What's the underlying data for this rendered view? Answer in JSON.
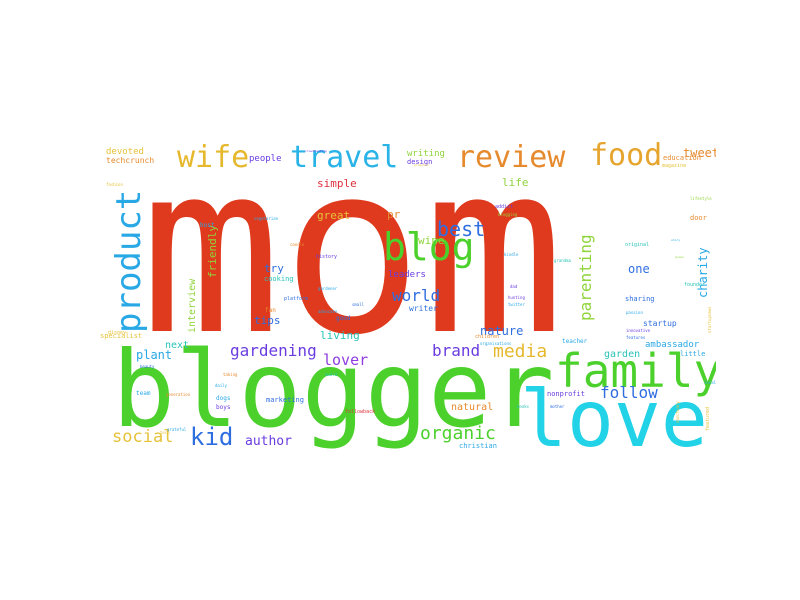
{
  "colors": {
    "red": "#e03a1e",
    "green": "#4cd12c",
    "cyan": "#22d2e6",
    "orange": "#e68a2e",
    "blue": "#2f6ee0",
    "purple": "#6a3ce0",
    "yellow": "#e6c23a",
    "lime": "#8fd43a",
    "teal": "#29c3b8"
  },
  "words": [
    {
      "text": "mom",
      "color": "#e03a1e"
    },
    {
      "text": "blogger",
      "color": "#4cd12c"
    },
    {
      "text": "love",
      "color": "#22d2e6"
    },
    {
      "text": "family",
      "color": "#4cd12c"
    },
    {
      "text": "review",
      "color": "#e68a2e"
    },
    {
      "text": "food",
      "color": "#e6a52e"
    },
    {
      "text": "travel",
      "color": "#29b3e6"
    },
    {
      "text": "wife",
      "color": "#e6b82e"
    },
    {
      "text": "product",
      "color": "#29a8e6"
    },
    {
      "text": "blog",
      "color": "#4cd12c"
    },
    {
      "text": "best",
      "color": "#2f6ee0"
    },
    {
      "text": "world",
      "color": "#2f6ee0"
    },
    {
      "text": "parenting",
      "color": "#8fd43a"
    },
    {
      "text": "kid",
      "color": "#2f6ee0"
    },
    {
      "text": "gardening",
      "color": "#6a3ce0"
    },
    {
      "text": "brand",
      "color": "#6a3ce0"
    },
    {
      "text": "media",
      "color": "#e6b82e"
    },
    {
      "text": "organic",
      "color": "#4cd12c"
    },
    {
      "text": "social",
      "color": "#e6c23a"
    },
    {
      "text": "follow",
      "color": "#2f6ee0"
    },
    {
      "text": "lover",
      "color": "#8f3ce0"
    },
    {
      "text": "author",
      "color": "#6a3ce0"
    },
    {
      "text": "living",
      "color": "#29c3b8"
    },
    {
      "text": "nature",
      "color": "#2f6ee0"
    },
    {
      "text": "plant",
      "color": "#29a8e6"
    },
    {
      "text": "one",
      "color": "#2f6ee0"
    },
    {
      "text": "charity",
      "color": "#29a8e6"
    },
    {
      "text": "tweet",
      "color": "#e68a2e"
    },
    {
      "text": "life",
      "color": "#8fd43a"
    },
    {
      "text": "simple",
      "color": "#e0303e"
    },
    {
      "text": "wine",
      "color": "#8fd43a"
    },
    {
      "text": "pr",
      "color": "#e68a2e"
    },
    {
      "text": "great",
      "color": "#e6c23a"
    },
    {
      "text": "friendly",
      "color": "#8fd43a"
    },
    {
      "text": "interview",
      "color": "#8fd43a"
    },
    {
      "text": "try",
      "color": "#2f6ee0"
    },
    {
      "text": "tips",
      "color": "#2f6ee0"
    },
    {
      "text": "next",
      "color": "#29c3b8"
    },
    {
      "text": "garden",
      "color": "#29c3b8"
    },
    {
      "text": "natural",
      "color": "#e68a2e"
    },
    {
      "text": "ambassador",
      "color": "#29a8e6"
    },
    {
      "text": "startup",
      "color": "#2f6ee0"
    },
    {
      "text": "devoted",
      "color": "#e6c23a"
    },
    {
      "text": "techcrunch",
      "color": "#e68a2e"
    },
    {
      "text": "people",
      "color": "#6a3ce0"
    },
    {
      "text": "writing",
      "color": "#8fd43a"
    },
    {
      "text": "design",
      "color": "#6a3ce0"
    },
    {
      "text": "education",
      "color": "#e68a2e"
    },
    {
      "text": "leaders",
      "color": "#6a3ce0"
    },
    {
      "text": "writer",
      "color": "#2f6ee0"
    },
    {
      "text": "cooking",
      "color": "#29c3b8"
    },
    {
      "text": "marketing",
      "color": "#2f6ee0"
    },
    {
      "text": "nonprofit",
      "color": "#6a3ce0"
    },
    {
      "text": "sharing",
      "color": "#2f6ee0"
    },
    {
      "text": "little",
      "color": "#29a8e6"
    },
    {
      "text": "christian",
      "color": "#29a8e6"
    },
    {
      "text": "dogs",
      "color": "#29a8e6"
    },
    {
      "text": "boys",
      "color": "#6a3ce0"
    },
    {
      "text": "team",
      "color": "#29a8e6"
    },
    {
      "text": "good",
      "color": "#2f6ee0"
    },
    {
      "text": "teacher",
      "color": "#29a8e6"
    },
    {
      "text": "specialist",
      "color": "#e6c23a"
    },
    {
      "text": "fan",
      "color": "#e68a2e"
    },
    {
      "text": "door",
      "color": "#e68a2e"
    },
    {
      "text": "host",
      "color": "#29a8e6"
    },
    {
      "text": "platform",
      "color": "#2f6ee0"
    },
    {
      "text": "history",
      "color": "#6a3ce0"
    },
    {
      "text": "gardener",
      "color": "#29a8e6"
    },
    {
      "text": "founder",
      "color": "#29c3b8"
    },
    {
      "text": "original",
      "color": "#29c3b8"
    },
    {
      "text": "children",
      "color": "#e68a2e"
    },
    {
      "text": "organisations",
      "color": "#29a8e6"
    },
    {
      "text": "hunting",
      "color": "#6a3ce0"
    },
    {
      "text": "lifestyle",
      "color": "#8fd43a"
    },
    {
      "text": "magazine",
      "color": "#e6c23a"
    },
    {
      "text": "twitter",
      "color": "#29a8e6"
    },
    {
      "text": "addict",
      "color": "#6a3ce0"
    },
    {
      "text": "blogging",
      "color": "#8fd43a"
    },
    {
      "text": "daily",
      "color": "#29a8e6"
    },
    {
      "text": "taking",
      "color": "#e68a2e"
    },
    {
      "text": "grateful",
      "color": "#29a8e6"
    },
    {
      "text": "followback",
      "color": "#e0303e"
    },
    {
      "text": "books",
      "color": "#29c3b8"
    },
    {
      "text": "mother",
      "color": "#2f6ee0"
    },
    {
      "text": "features",
      "color": "#2f6ee0"
    },
    {
      "text": "innovative",
      "color": "#6a3ce0"
    },
    {
      "text": "passion",
      "color": "#29a8e6"
    },
    {
      "text": "award",
      "color": "#29c3b8"
    },
    {
      "text": "small",
      "color": "#2f6ee0"
    },
    {
      "text": "advocate",
      "color": "#29a8e6"
    },
    {
      "text": "generation",
      "color": "#e68a2e"
    },
    {
      "text": "beauty",
      "color": "#2f6ee0"
    },
    {
      "text": "sanctuary",
      "color": "#e6c23a"
    },
    {
      "text": "startupnews",
      "color": "#e6c23a"
    },
    {
      "text": "local",
      "color": "#29a8e6"
    },
    {
      "text": "featured",
      "color": "#e6c23a"
    },
    {
      "text": "tech",
      "color": "#e6c23a"
    },
    {
      "text": "disney",
      "color": "#e6c23a"
    },
    {
      "text": "fashion",
      "color": "#e6c23a"
    },
    {
      "text": "candle",
      "color": "#e68a2e"
    },
    {
      "text": "vegetarian",
      "color": "#29a8e6"
    },
    {
      "text": "crowdfunding",
      "color": "#6a3ce0"
    },
    {
      "text": "grandma",
      "color": "#29c3b8"
    },
    {
      "text": "promoted",
      "color": "#e6c23a"
    },
    {
      "text": "story",
      "color": "#29a8e6"
    },
    {
      "text": "green",
      "color": "#8fd43a"
    },
    {
      "text": "dad",
      "color": "#6a3ce0"
    },
    {
      "text": "kindle",
      "color": "#29a8e6"
    }
  ]
}
